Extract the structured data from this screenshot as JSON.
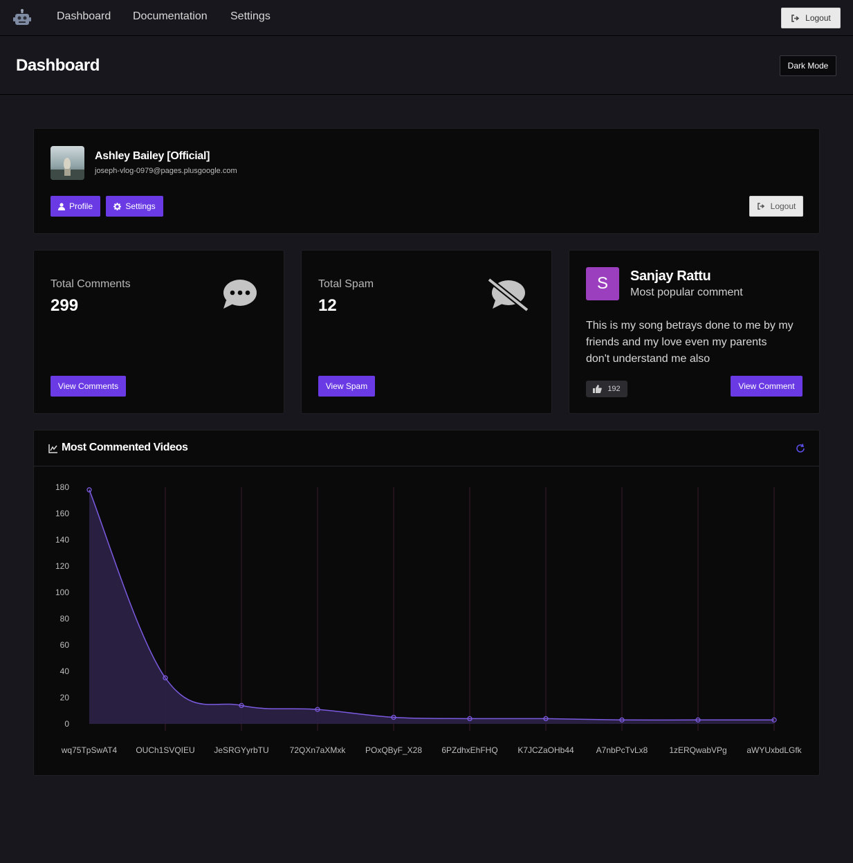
{
  "nav": {
    "logo_icon": "robot-icon",
    "links": [
      "Dashboard",
      "Documentation",
      "Settings"
    ],
    "logout_label": "Logout"
  },
  "header": {
    "title": "Dashboard",
    "dark_mode_label": "Dark Mode"
  },
  "profile": {
    "name": "Ashley Bailey [Official]",
    "email": "joseph-vlog-0979@pages.plusgoogle.com",
    "profile_label": "Profile",
    "settings_label": "Settings",
    "logout_label": "Logout"
  },
  "stats": {
    "comments": {
      "label": "Total Comments",
      "value": "299",
      "button": "View Comments",
      "icon": "comment-dots-icon"
    },
    "spam": {
      "label": "Total Spam",
      "value": "12",
      "button": "View Spam",
      "icon": "comment-slash-icon"
    }
  },
  "popular": {
    "initial": "S",
    "name": "Sanjay Rattu",
    "subtitle": "Most popular comment",
    "text": "This is my song betrays done to me by my friends and my love even my parents don't understand me also",
    "likes": "192",
    "button": "View Comment"
  },
  "chart_section": {
    "title": "Most Commented Videos"
  },
  "colors": {
    "accent": "#6a3be4",
    "line": "#7b5ae0",
    "area": "#2a2145",
    "background": "#18171d",
    "card": "#0a0a0b"
  },
  "chart_data": {
    "type": "area",
    "categories": [
      "wq75TpSwAT4",
      "OUCh1SVQIEU",
      "JeSRGYyrbTU",
      "72QXn7aXMxk",
      "POxQByF_X28",
      "6PZdhxEhFHQ",
      "K7JCZaOHb44",
      "A7nbPcTvLx8",
      "1zERQwabVPg",
      "aWYUxbdLGfk"
    ],
    "values": [
      178,
      35,
      14,
      11,
      5,
      4,
      4,
      3,
      3,
      3
    ],
    "yticks": [
      0,
      20,
      40,
      60,
      80,
      100,
      120,
      140,
      160,
      180
    ],
    "ylim": [
      0,
      180
    ],
    "title": "Most Commented Videos",
    "xlabel": "",
    "ylabel": "",
    "grid": "vertical",
    "legend": "none"
  }
}
